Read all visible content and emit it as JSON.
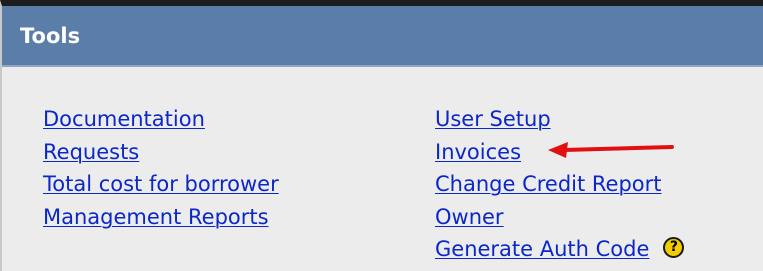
{
  "panel": {
    "title": "Tools"
  },
  "links": {
    "left": [
      {
        "label": "Documentation"
      },
      {
        "label": "Requests"
      },
      {
        "label": "Total cost for borrower"
      },
      {
        "label": "Management Reports"
      }
    ],
    "right": [
      {
        "label": "User Setup"
      },
      {
        "label": "Invoices"
      },
      {
        "label": "Change Credit Report"
      },
      {
        "label": "Owner"
      },
      {
        "label": "Generate Auth Code"
      }
    ]
  },
  "help": {
    "glyph": "?",
    "icon": "help-question-icon"
  },
  "annotation": {
    "arrow_color": "#e01010",
    "points_to": "Invoices"
  },
  "colors": {
    "header_bg": "#5b7ea8",
    "panel_bg": "#ececec",
    "link": "#0c27c8"
  }
}
